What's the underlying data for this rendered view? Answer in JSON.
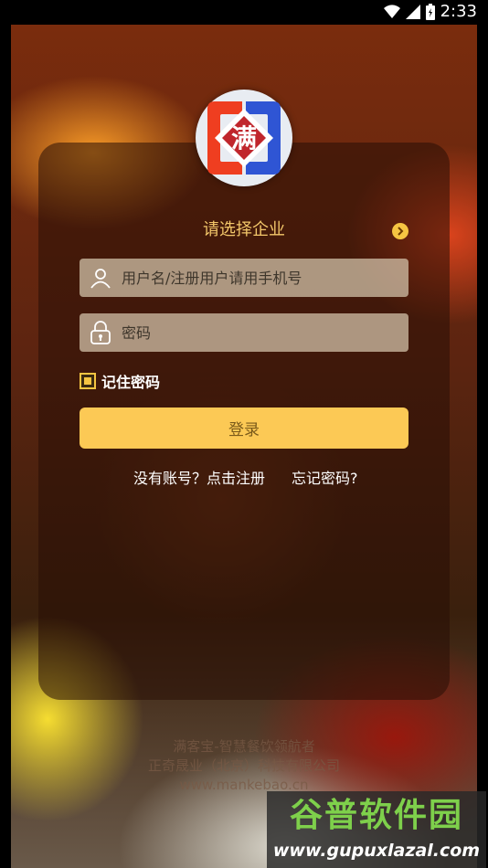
{
  "status_bar": {
    "time": "2:33",
    "icons": [
      "wifi-icon",
      "signal-icon",
      "battery-icon"
    ]
  },
  "logo": {
    "char": "满",
    "colors": {
      "left": "#ef3e20",
      "right": "#2f55d4",
      "center": "#c0262c"
    }
  },
  "enterprise": {
    "label": "请选择企业"
  },
  "username": {
    "placeholder": "用户名/注册用户请用手机号",
    "value": ""
  },
  "password": {
    "placeholder": "密码",
    "value": ""
  },
  "remember": {
    "label": "记住密码",
    "checked": true
  },
  "login_button": {
    "label": "登录"
  },
  "links": {
    "register": "没有账号？点击注册",
    "forgot": "忘记密码?"
  },
  "footer": {
    "line1": "满客宝-智慧餐饮领航者",
    "line2": "正奇晟业（北京）科技有限公司",
    "line3": "www.mankebao.cn"
  },
  "watermark": {
    "title": "谷普软件园",
    "url": "www.gupuxlazal.com"
  },
  "colors": {
    "accent": "#fcc955",
    "enterprise_text": "#f3c76a",
    "watermark_green": "#7ed04b"
  }
}
